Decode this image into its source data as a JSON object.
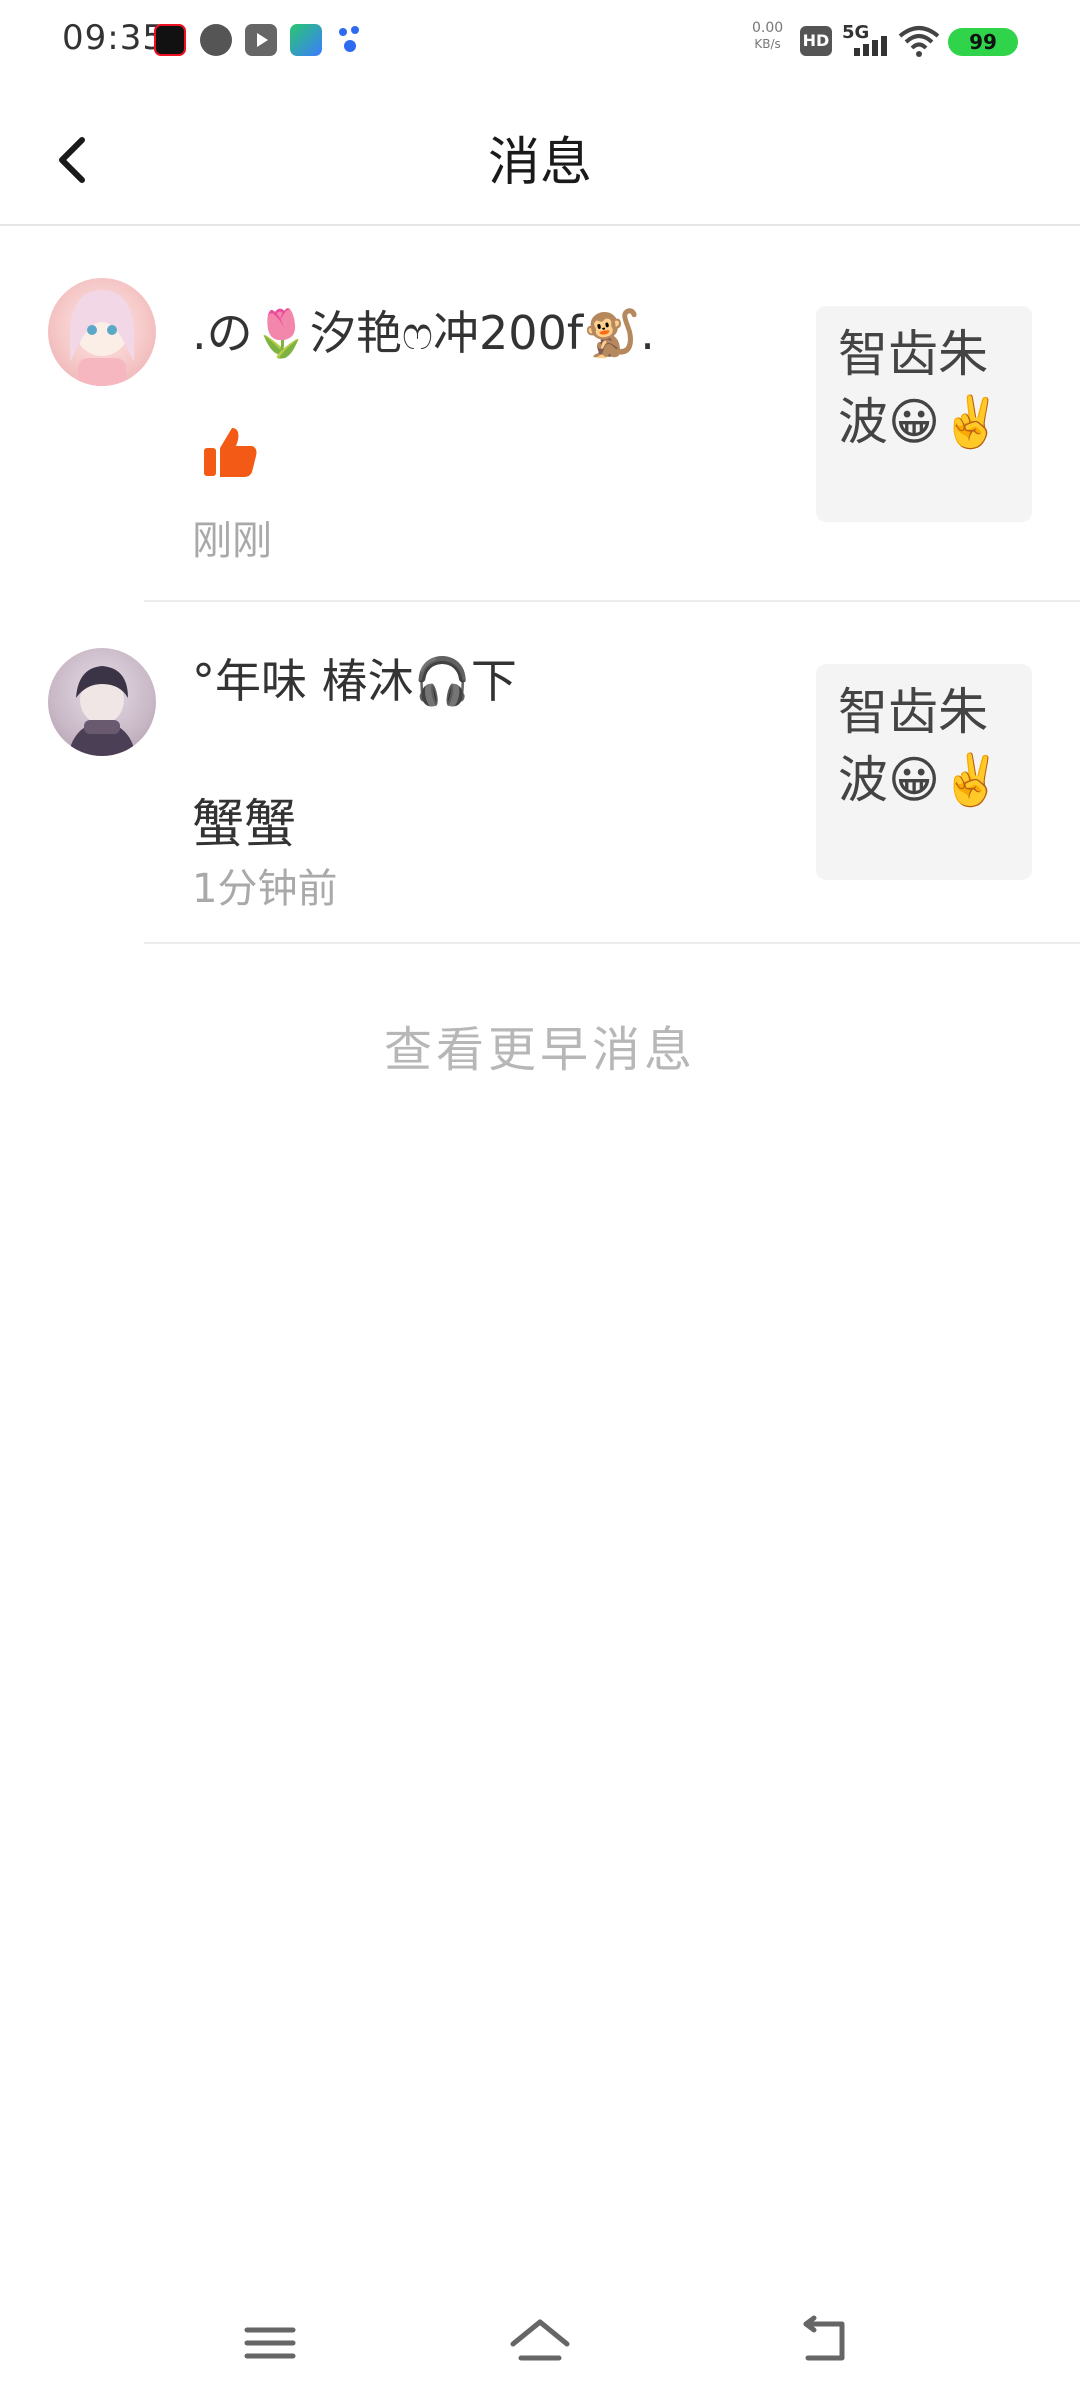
{
  "status_bar": {
    "time": "09:35",
    "network_speed": "0.00",
    "network_unit": "KB/s",
    "hd": "HD",
    "signal": "5G",
    "battery": "99"
  },
  "header": {
    "title": "消息"
  },
  "messages": [
    {
      "name": ".の🌷汐艳ෆ冲200f🐒.",
      "content": "👍",
      "time": "刚刚",
      "preview": "智齿朱波😀✌️"
    },
    {
      "name": "°年味 椿沐🎧下",
      "content": "蟹蟹",
      "time": "1分钟前",
      "preview": "智齿朱波😀✌️"
    }
  ],
  "more_label": "查看更早消息",
  "colors": {
    "accent_thumb": "#f25a15",
    "battery": "#2fd44a",
    "divider": "#ececec"
  }
}
